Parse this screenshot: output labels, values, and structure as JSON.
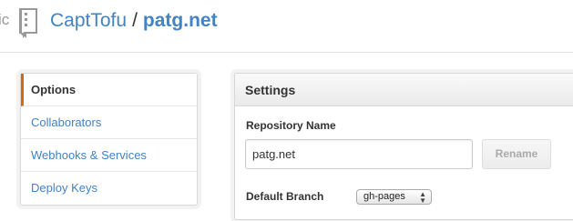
{
  "header": {
    "cut_prefix": "ic",
    "owner": "CaptTofu",
    "separator": "/",
    "repo_name": "patg.net",
    "icon": "repo-icon"
  },
  "sidebar": {
    "items": [
      {
        "label": "Options",
        "selected": true
      },
      {
        "label": "Collaborators",
        "selected": false
      },
      {
        "label": "Webhooks & Services",
        "selected": false
      },
      {
        "label": "Deploy Keys",
        "selected": false
      }
    ]
  },
  "settings": {
    "title": "Settings",
    "repo_name_label": "Repository Name",
    "repo_name_value": "patg.net",
    "rename_label": "Rename",
    "default_branch_label": "Default Branch",
    "default_branch_value": "gh-pages"
  },
  "colors": {
    "link": "#4183c4",
    "selected_accent": "#d26911"
  }
}
